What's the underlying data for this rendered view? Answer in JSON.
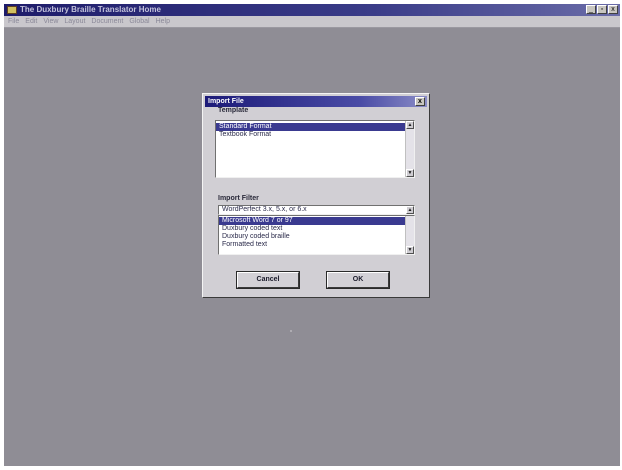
{
  "window": {
    "title": "The Duxbury Braille Translator Home",
    "controls": [
      "_",
      "▫",
      "x"
    ]
  },
  "menubar": {
    "items": [
      "File",
      "Edit",
      "View",
      "Layout",
      "Document",
      "Global",
      "Help"
    ]
  },
  "dialog": {
    "title": "Import File",
    "close_label": "x",
    "template": {
      "label": "Template",
      "items": [
        "Standard Format",
        "Textbook Format"
      ],
      "selected_index": 0
    },
    "import_filter": {
      "label": "Import Filter",
      "current_value": "WordPerfect 3.x, 5.x, or 6.x",
      "items": [
        "Microsoft Word 7 or 97",
        "Duxbury coded text",
        "Duxbury coded braille",
        "Formatted text"
      ],
      "selected_index": 0
    },
    "cancel_label": "Cancel",
    "ok_label": "OK"
  },
  "icons": {
    "scroll_up": "▲",
    "scroll_down": "▼"
  },
  "colors": {
    "desktop": "#8f8d95",
    "selection": "#3a3a90",
    "dialog_face": "#d1cfd4",
    "titlebar": "#1e1c6a"
  }
}
